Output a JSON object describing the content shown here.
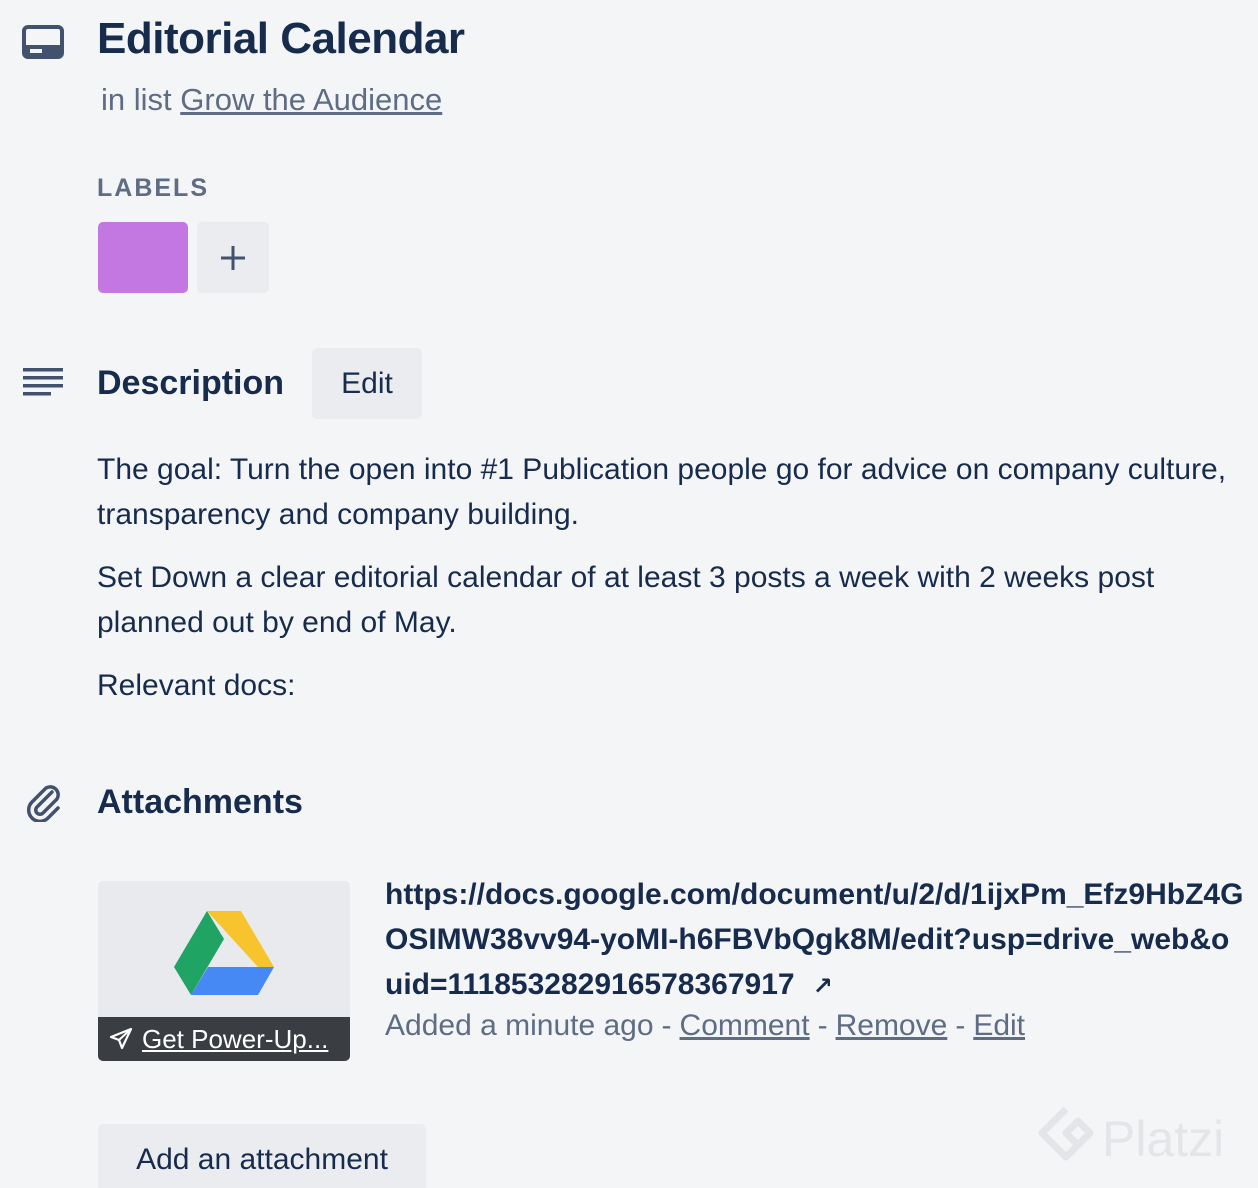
{
  "card": {
    "title": "Editorial Calendar",
    "in_list_prefix": "in list",
    "list_name": "Grow the Audience"
  },
  "labels": {
    "heading": "LABELS",
    "items": [
      {
        "color": "#c377e0"
      }
    ],
    "add_symbol": "+"
  },
  "description": {
    "heading": "Description",
    "edit_label": "Edit",
    "paragraphs": [
      "The goal: Turn the open into #1 Publication people go for advice on company culture, transparency and company building.",
      "Set Down a clear editorial calendar of at least 3 posts a week with 2 weeks post planned out by end of May.",
      "Relevant docs:"
    ]
  },
  "attachments": {
    "heading": "Attachments",
    "items": [
      {
        "url": "https://docs.google.com/document/u/2/d/1ijxPm_Efz9HbZ4GOSIMW38vv94-yoMI-h6FBVbQgk8M/edit?usp=drive_web&ouid=111853282916578367917",
        "external_icon": "↗",
        "added": "Added a minute ago",
        "separator": "-",
        "comment_label": "Comment",
        "remove_label": "Remove",
        "edit_label": "Edit",
        "power_up_label": "Get Power-Up..."
      }
    ],
    "add_label": "Add an attachment"
  },
  "watermark": {
    "text": "Platzi"
  },
  "colors": {
    "background": "#f4f5f7",
    "label_purple": "#c377e0",
    "button_gray": "#ebecf0",
    "text_dark": "#172b4d",
    "text_muted": "#5e6c84"
  }
}
